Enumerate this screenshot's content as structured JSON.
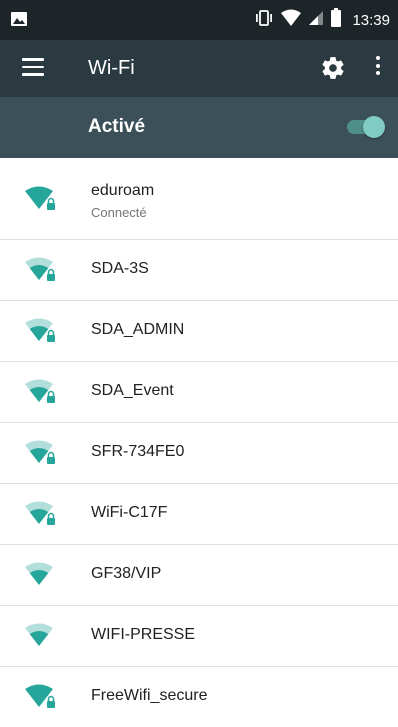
{
  "status_bar": {
    "time": "13:39",
    "icons": [
      "image-icon",
      "vibrate-icon",
      "wifi-signal-icon",
      "cell-signal-icon",
      "battery-icon"
    ]
  },
  "toolbar": {
    "title": "Wi-Fi",
    "menu_icon": "hamburger-menu-icon",
    "settings_icon": "gear-icon",
    "overflow_icon": "more-vert-icon"
  },
  "master_switch": {
    "label": "Activé",
    "checked": true
  },
  "networks": [
    {
      "ssid": "eduroam",
      "summary": "Connecté",
      "secured": true,
      "strength": "full"
    },
    {
      "ssid": "SDA-3S",
      "summary": "",
      "secured": true,
      "strength": "partial"
    },
    {
      "ssid": "SDA_ADMIN",
      "summary": "",
      "secured": true,
      "strength": "partial"
    },
    {
      "ssid": "SDA_Event",
      "summary": "",
      "secured": true,
      "strength": "partial"
    },
    {
      "ssid": "SFR-734FE0",
      "summary": "",
      "secured": true,
      "strength": "partial"
    },
    {
      "ssid": "WiFi-C17F",
      "summary": "",
      "secured": true,
      "strength": "partial"
    },
    {
      "ssid": "GF38/VIP",
      "summary": "",
      "secured": false,
      "strength": "partial"
    },
    {
      "ssid": "WIFI-PRESSE",
      "summary": "",
      "secured": false,
      "strength": "partial"
    },
    {
      "ssid": "FreeWifi_secure",
      "summary": "",
      "secured": true,
      "strength": "full"
    }
  ],
  "colors": {
    "status_bar": "#1e2529",
    "toolbar": "#2b3a40",
    "switch_bar": "#3b5058",
    "accent": "#26a69a",
    "accent_light": "#80cbc4"
  }
}
